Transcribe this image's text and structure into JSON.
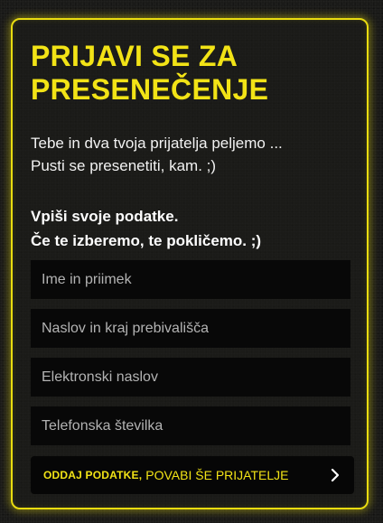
{
  "form": {
    "title": "PRIJAVI SE ZA PRESENEČENJE",
    "intro_lines": [
      "Tebe in dva tvoja prijatelja peljemo ...",
      "Pusti se presenetiti, kam. ;)"
    ],
    "prompt_lines": [
      "Vpiši svoje podatke.",
      "Če te izberemo, te pokličemo. ;)"
    ],
    "fields": {
      "name_placeholder": "Ime in priimek",
      "address_placeholder": "Naslov in kraj prebivališča",
      "email_placeholder": "Elektronski naslov",
      "phone_placeholder": "Telefonska številka"
    },
    "submit": {
      "strong_label": "ODDAJ PODATKE,",
      "light_label": "POVABI ŠE PRIJATELJE",
      "icon": "chevron-right-icon"
    }
  },
  "colors": {
    "accent": "#f2e316",
    "background": "#1a1a18",
    "field_background": "#080808"
  }
}
